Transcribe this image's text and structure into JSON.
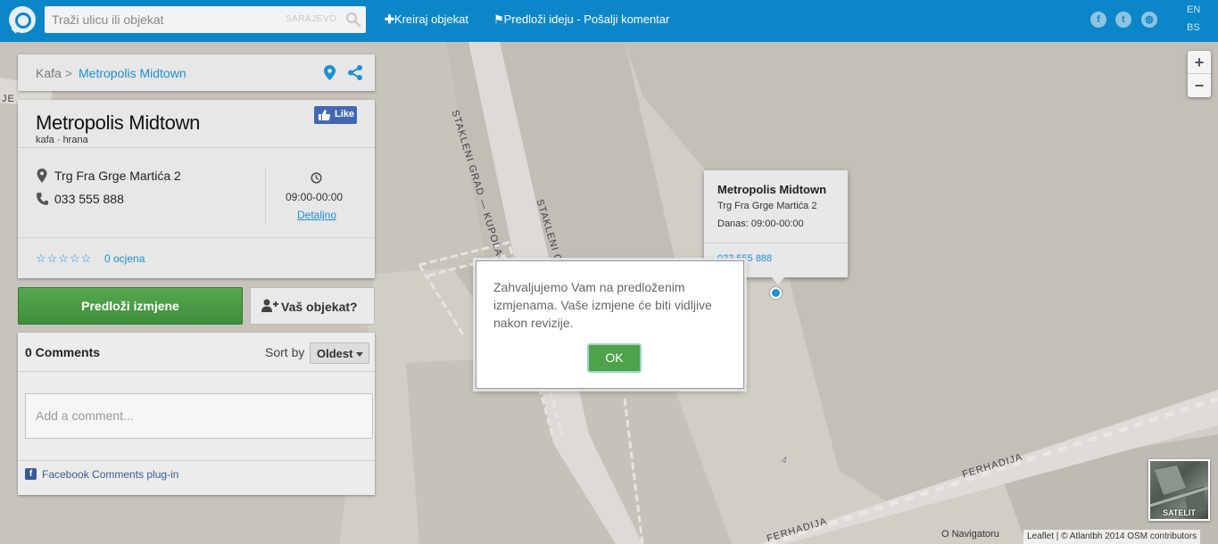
{
  "header": {
    "search_placeholder": "Traži ulicu ili objekat",
    "city": "SARAJEVO",
    "create_label": "Kreiraj objekat",
    "suggest_label": "Predloži ideju - Pošalji komentar",
    "languages": [
      "EN",
      "BS"
    ],
    "colors": {
      "bar": "#0b86c8"
    }
  },
  "breadcrumb": {
    "category": "Kafa",
    "separator": ">",
    "current": "Metropolis Midtown"
  },
  "place": {
    "name": "Metropolis Midtown",
    "tags": "kafa · hrana",
    "like_label": "Like",
    "address": "Trg Fra Grge Martića 2",
    "phone": "033 555 888",
    "hours": "09:00-00:00",
    "details_link": "Detaljno",
    "stars": "☆☆☆☆☆",
    "rating_count": "0 ocjena"
  },
  "buttons": {
    "suggest_changes": "Predloži izmjene",
    "your_place": "Vaš objekat?"
  },
  "comments": {
    "count_label": "0 Comments",
    "sort_by": "Sort by",
    "sort_value": "Oldest",
    "placeholder": "Add a comment...",
    "plugin_label": "Facebook Comments plug-in"
  },
  "popup": {
    "title": "Metropolis Midtown",
    "address": "Trg Fra Grge Martića 2",
    "today": "Danas: 09:00-00:00",
    "phone": "033 555 888"
  },
  "map": {
    "street_labels": [
      "STAKLENI GRAD — KUPOLA",
      "STAKLENI GRAD",
      "FERHADIJA",
      "FERHADIJA",
      "JE"
    ],
    "building_number": "4",
    "zoom_in": "+",
    "zoom_out": "−",
    "satellite_label": "SATELIT",
    "navigator": "O Navigatoru",
    "attribution": "Leaflet | © Atlantbh 2014 OSM contributors"
  },
  "modal": {
    "message": "Zahvaljujemo Vam na predloženim izmjenama. Vaše izmjene će biti vidljive nakon revizije.",
    "ok_label": "OK"
  }
}
